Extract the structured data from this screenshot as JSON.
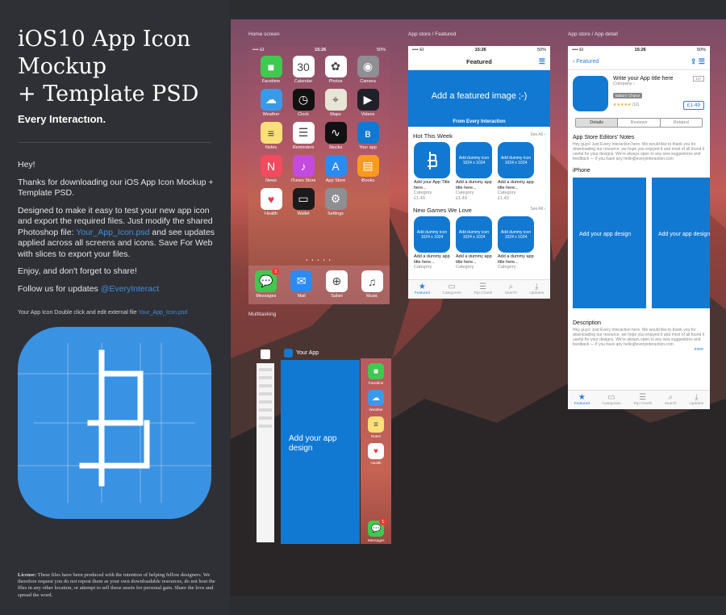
{
  "left": {
    "title_lines": [
      "iOS10 App Icon",
      "Mockup",
      "+ Template PSD"
    ],
    "brand": "Every Interactιon.",
    "greeting": "Hey!",
    "p1": "Thanks for downloading our iOS App Icon Mockup + Template PSD.",
    "p2_before": "Designed to make it easy to test your new app icon and export the required files. Just modify the shared Photoshop file: ",
    "p2_link": "Your_App_Icon.psd",
    "p2_after": " and see updates applied across all screens and icons. Save For Web with slices to export your files.",
    "p3": "Enjoy, and don't forget to share!",
    "p4_before": "Follow us for updates ",
    "p4_link": "@EveryInteract",
    "icon_caption_before": "Your App Icon Double click and edit external file ",
    "icon_caption_link": "Your_App_Icon.psd",
    "license_label": "License:",
    "license_text": " These files have been produced with the intention of helping fellow designers. We therefore request you do not repost them as your own downloadable resources, do not host the files in any other location, or attempt to sell these assets for personal gain. Share the love and spread the word."
  },
  "captions": {
    "home": "Home screen",
    "featured": "App store / Featured",
    "detail": "App store / App detail",
    "multitasking": "Multitasking"
  },
  "status": {
    "carrier": "•••• EI",
    "time": "15:26",
    "battery": "50%"
  },
  "home": {
    "apps": [
      {
        "label": "Facetime",
        "color": "#3fc950",
        "icon": "facetime-icon",
        "glyph": "■"
      },
      {
        "label": "Calendar",
        "color": "#ffffff",
        "icon": "calendar-icon",
        "glyph": "30"
      },
      {
        "label": "Photos",
        "color": "#ffffff",
        "icon": "photos-icon",
        "glyph": "✿"
      },
      {
        "label": "Camera",
        "color": "#8e8e93",
        "icon": "camera-icon",
        "glyph": "◉"
      },
      {
        "label": "Weather",
        "color": "#3a9ae8",
        "icon": "weather-icon",
        "glyph": "☁"
      },
      {
        "label": "Clock",
        "color": "#111111",
        "icon": "clock-icon",
        "glyph": "◷"
      },
      {
        "label": "Maps",
        "color": "#e8e4d6",
        "icon": "maps-icon",
        "glyph": "⌖"
      },
      {
        "label": "Videos",
        "color": "#202028",
        "icon": "videos-icon",
        "glyph": "▶"
      },
      {
        "label": "Notes",
        "color": "#fbe07a",
        "icon": "notes-icon",
        "glyph": "≡"
      },
      {
        "label": "Reminders",
        "color": "#ffffff",
        "icon": "reminders-icon",
        "glyph": "☰"
      },
      {
        "label": "Stocks",
        "color": "#111111",
        "icon": "stocks-icon",
        "glyph": "∿"
      },
      {
        "label": "Your app",
        "color": "#1279d2",
        "icon": "your-app-icon",
        "glyph": "ʙ"
      },
      {
        "label": "News",
        "color": "#f24a5e",
        "icon": "news-icon",
        "glyph": "N"
      },
      {
        "label": "iTunes Store",
        "color": "#c34be0",
        "icon": "itunes-icon",
        "glyph": "♪"
      },
      {
        "label": "App Store",
        "color": "#2a8cf2",
        "icon": "app-store-icon",
        "glyph": "A"
      },
      {
        "label": "iBooks",
        "color": "#f79a1e",
        "icon": "ibooks-icon",
        "glyph": "▤"
      },
      {
        "label": "Health",
        "color": "#ffffff",
        "icon": "health-icon",
        "glyph": "♥"
      },
      {
        "label": "Wallet",
        "color": "#1b1b1b",
        "icon": "wallet-icon",
        "glyph": "▭"
      },
      {
        "label": "Settings",
        "color": "#8e8e93",
        "icon": "settings-icon",
        "glyph": "⚙"
      }
    ],
    "dock": [
      {
        "label": "Messages",
        "color": "#3fc950",
        "icon": "messages-icon",
        "glyph": "💬",
        "badge": "1"
      },
      {
        "label": "Mail",
        "color": "#2a8cf2",
        "icon": "mail-icon",
        "glyph": "✉",
        "badge": ""
      },
      {
        "label": "Safari",
        "color": "#ffffff",
        "icon": "safari-icon",
        "glyph": "⊕",
        "badge": ""
      },
      {
        "label": "Music",
        "color": "#ffffff",
        "icon": "music-icon",
        "glyph": "♫",
        "badge": ""
      }
    ]
  },
  "featured": {
    "title": "Featured",
    "banner": "Add a featured image ;-)",
    "banner_sub": "From Every Interaction",
    "section1": "Hot This Week",
    "section2": "New Games We Love",
    "see_all": "See All",
    "tile_placeholder": "Add dummy icon",
    "tile_size": "1024 x 1024",
    "row1": [
      {
        "name": "Add your App Title here...",
        "cat": "Category",
        "price": "£1.49",
        "own": true
      },
      {
        "name": "Add a dummy app title here...",
        "cat": "Category",
        "price": "£1.49",
        "own": false
      },
      {
        "name": "Add a dummy app title here...",
        "cat": "Category",
        "price": "£1.49",
        "own": false
      }
    ],
    "row2": [
      {
        "name": "Add a dummy app title here...",
        "cat": "Category",
        "price": "",
        "own": false
      },
      {
        "name": "Add a dummy app title here...",
        "cat": "Category",
        "price": "",
        "own": false
      },
      {
        "name": "Add a dummy app title here...",
        "cat": "Category",
        "price": "",
        "own": false
      }
    ],
    "tabs": [
      "Featured",
      "Categories",
      "Top Charts",
      "Search",
      "Updates"
    ]
  },
  "detail": {
    "back": "Featured",
    "app_title": "Write your App title here",
    "company": "Company",
    "editors_choice": "Editors' Choice",
    "rating_count": "(11)",
    "age": "12+",
    "price": "£1.49",
    "segments": [
      "Details",
      "Reviews",
      "Related"
    ],
    "editors_notes": "App Store Editors' Notes",
    "notes_text": "Hey guys! Just Every Interaction here. We would like to thank you for downloading our resource, we hope you enjoyed it and most of all found it useful for your designs. We're always open to any new suggestions and feedback — if you have any hello@everyinteraction.com",
    "iphone": "iPhone",
    "shot_text": "Add your app design",
    "description": "Description",
    "desc_text": "Hey guys! Just Every Interaction here. We would like to thank you for downloading our resource, we hope you enjoyed it and most of all found it useful for your designs. We're always open to any new suggestions and feedback — if you have any hello@everyinteraction.com",
    "more": "more"
  },
  "multi": {
    "app_label": "Your App",
    "design_text": "Add your app design",
    "strip_apps": [
      {
        "label": "Facetime",
        "color": "#3fc950",
        "icon": "facetime-icon",
        "glyph": "■"
      },
      {
        "label": "Weather",
        "color": "#3a9ae8",
        "icon": "weather-icon",
        "glyph": "☁"
      },
      {
        "label": "Notes",
        "color": "#fbe07a",
        "icon": "notes-icon",
        "glyph": "≡"
      },
      {
        "label": "Health",
        "color": "#ffffff",
        "icon": "health-icon",
        "glyph": "♥"
      }
    ],
    "strip_bottom": {
      "label": "Messages",
      "color": "#3fc950",
      "icon": "messages-icon",
      "glyph": "💬",
      "badge": "1"
    }
  }
}
